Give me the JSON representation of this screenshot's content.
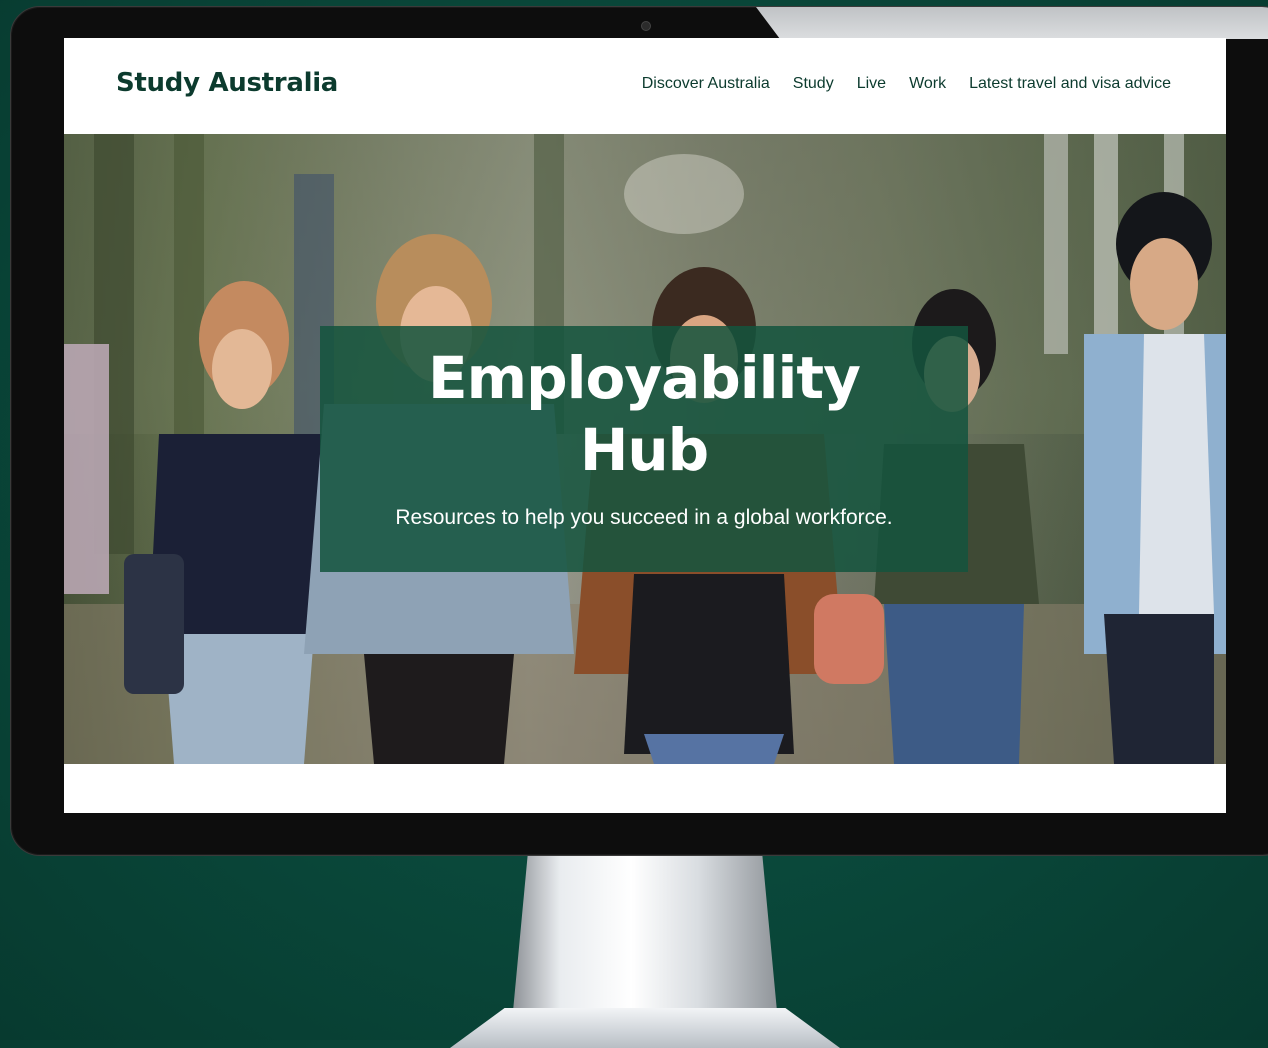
{
  "site": {
    "logo": "Study Australia"
  },
  "nav": {
    "items": [
      {
        "label": "Discover Australia"
      },
      {
        "label": "Study"
      },
      {
        "label": "Live"
      },
      {
        "label": "Work"
      },
      {
        "label": "Latest travel and visa advice"
      }
    ]
  },
  "hero": {
    "title_line1": "Employability",
    "title_line2": "Hub",
    "subtitle": "Resources to help you succeed in a global workforce."
  },
  "colors": {
    "background": "#0a4a3c",
    "brand_dark_green": "#0c3b2e",
    "hero_box_green": "#14543e",
    "text_white": "#ffffff"
  }
}
